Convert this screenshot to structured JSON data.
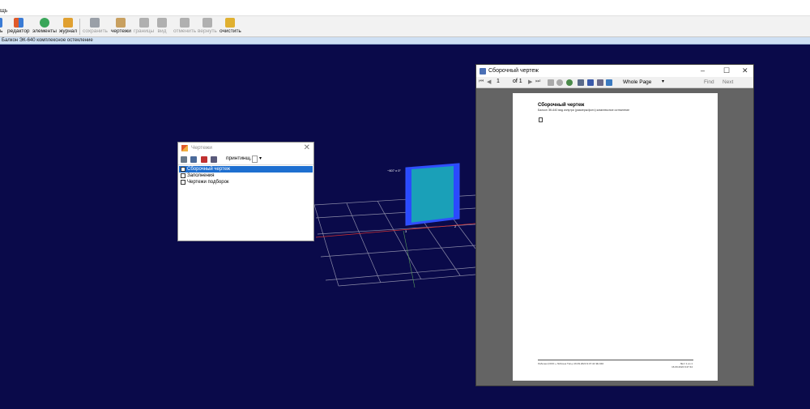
{
  "menubar": {
    "text": "щь"
  },
  "toolbar": {
    "buttons": [
      {
        "label": "ть",
        "icon": "file-icon",
        "color": "#3a7bd5",
        "enabled": true
      },
      {
        "label": "редактор",
        "icon": "editor-icon",
        "color": "#e05a2a",
        "enabled": true
      },
      {
        "label": "элементы",
        "icon": "elements-icon",
        "color": "#3aa65a",
        "enabled": true
      },
      {
        "label": "журнал",
        "icon": "journal-icon",
        "color": "#e0a030",
        "enabled": true
      },
      {
        "label": "сохранить",
        "icon": "save-icon",
        "color": "#9aa0a8",
        "enabled": false
      },
      {
        "label": "чертежи",
        "icon": "drawings-icon",
        "color": "#c8a060",
        "enabled": true
      },
      {
        "label": "границы",
        "icon": "bounds-icon",
        "color": "#b0b0b0",
        "enabled": false
      },
      {
        "label": "вид",
        "icon": "view-icon",
        "color": "#b0b0b0",
        "enabled": false
      },
      {
        "label": "отменить",
        "icon": "undo-icon",
        "color": "#b0b0b0",
        "enabled": false
      },
      {
        "label": "вернуть",
        "icon": "redo-icon",
        "color": "#b0b0b0",
        "enabled": false
      },
      {
        "label": "очистить",
        "icon": "clear-icon",
        "color": "#e0b030",
        "enabled": true
      }
    ]
  },
  "statusline": {
    "text": "Балкон ЭК-640 комплексное остекление"
  },
  "viewport": {
    "dim_top": "~607 x 0\"",
    "dim_bottom_left": "3",
    "dim_bottom_right": "2"
  },
  "drawings_window": {
    "title": "Чертежи",
    "combo_value": "принтинщ...",
    "items": [
      {
        "label": "Сборочный чертеж",
        "selected": true
      },
      {
        "label": "Заполнения",
        "selected": false
      },
      {
        "label": "Чертежи подборок",
        "selected": false
      }
    ]
  },
  "preview_window": {
    "title": "Сборочный чертеж",
    "page_number": "1",
    "page_of": "of 1",
    "zoom": "Whole Page",
    "find_label": "Find",
    "next_label": "Next",
    "page": {
      "title": "Сборочный чертеж",
      "subtitle": "Балкон ЭК-640 вид изнутри (размеры/фото) комплексное остекление",
      "footer_left": "Лобочек (ООО « Лобочек Тип») 16.09.2024 9:47:44 ЭК-640",
      "footer_right_1": "Лист 1 из 1",
      "footer_right_2": "16.09.2024 9:47:44"
    }
  }
}
